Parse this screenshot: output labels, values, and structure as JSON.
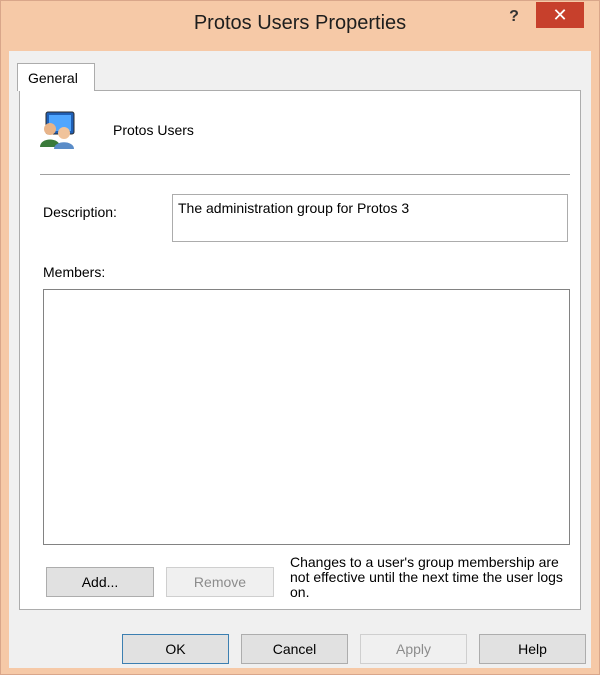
{
  "window": {
    "title": "Protos Users Properties",
    "help_glyph": "?",
    "close_glyph": "✕"
  },
  "tabs": [
    {
      "label": "General",
      "active": true
    }
  ],
  "group": {
    "icon": "users-group-icon",
    "name": "Protos Users"
  },
  "description": {
    "label": "Description:",
    "value": "The administration group for Protos 3"
  },
  "members": {
    "label": "Members:",
    "items": []
  },
  "buttons": {
    "add": "Add...",
    "remove": "Remove",
    "ok": "OK",
    "cancel": "Cancel",
    "apply": "Apply",
    "help": "Help"
  },
  "note": "Changes to a user's group membership are not effective until the next time the user logs on.",
  "colors": {
    "titlebar": "#f6c9a7",
    "close_button": "#c7402c",
    "dialog_background": "#f0f0f0"
  }
}
